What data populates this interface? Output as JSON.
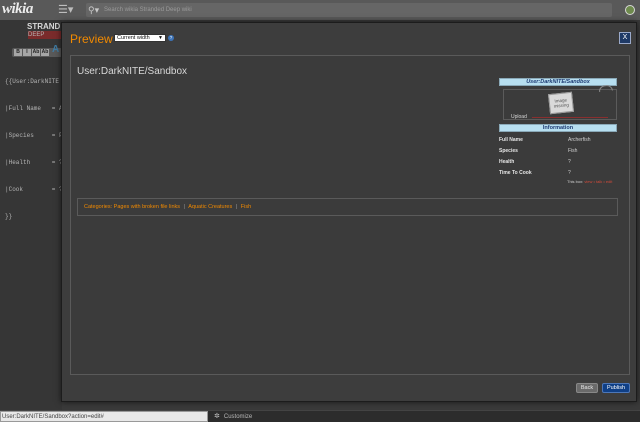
{
  "topbar": {
    "logo": "wikia",
    "search_placeholder": "Search wikia Stranded Deep wiki"
  },
  "background_page": {
    "title": "STRAND",
    "subtitle": "DEEP",
    "toolbar": [
      "B",
      "I",
      "Ab",
      "Ab"
    ],
    "big_letter": "A",
    "source_lines": [
      "{{User:DarkNITE",
      "|Full Name   = Ar",
      "|Species     = Fi",
      "|Health      = ?",
      "|Cook        = ?",
      "}}"
    ]
  },
  "modal": {
    "title": "Preview",
    "width_select": "Current width",
    "help_glyph": "?",
    "close_label": "X",
    "page_heading": "User:DarkNITE/Sandbox",
    "infobox": {
      "title": "User:DarkNITE/Sandbox",
      "image_text": "Image missing",
      "upload_label": "Upload",
      "info_header": "Information",
      "rows": [
        {
          "label": "Full Name",
          "value": "Archerfish"
        },
        {
          "label": "Species",
          "value": "Fish"
        },
        {
          "label": "Health",
          "value": "?"
        },
        {
          "label": "Time To Cook",
          "value": "?"
        }
      ],
      "nav_prefix": "This box:",
      "nav_view": "view",
      "nav_talk": "talk",
      "nav_edit": "edit"
    },
    "categories": {
      "label": "Categories:",
      "items": [
        "Pages with broken file links",
        "Aquatic Creatures",
        "Fish"
      ]
    },
    "back_label": "Back",
    "publish_label": "Publish"
  },
  "statusbar": {
    "url": "User:DarkNITE/Sandbox?action=edit#",
    "customize": "Customize"
  },
  "colors": {
    "accent_orange": "#f28a00",
    "infobox_header": "#b7dff0",
    "publish_blue": "#0f3f86"
  }
}
